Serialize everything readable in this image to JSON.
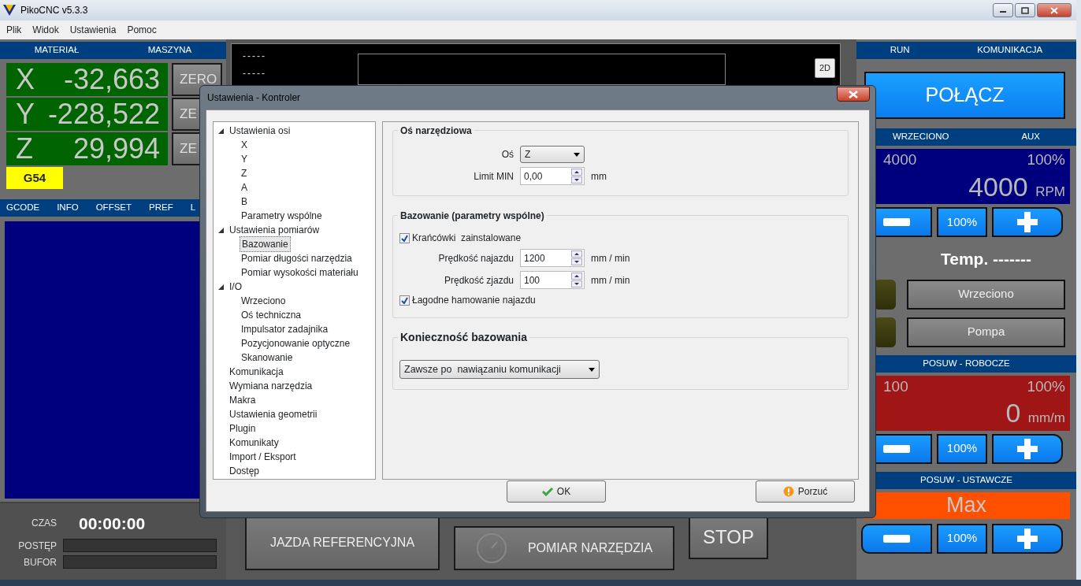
{
  "window": {
    "title": "PikoCNC v5.3.3"
  },
  "menu": [
    "Plik",
    "Widok",
    "Ustawienia",
    "Pomoc"
  ],
  "position": {
    "headers": [
      "MATERIAŁ",
      "MASZYNA"
    ],
    "axes": [
      {
        "axis": "X",
        "value": "-32,663",
        "button": "ZERO"
      },
      {
        "axis": "Y",
        "value": "-228,522",
        "button": "ZE"
      },
      {
        "axis": "Z",
        "value": "29,994",
        "button": "ZE"
      }
    ],
    "work_offset": "G54"
  },
  "left_tabs": [
    "GCODE",
    "INFO",
    "OFFSET",
    "PREF",
    "L"
  ],
  "status": {
    "time_label": "CZAS",
    "time": "00:00:00",
    "bars": [
      {
        "label": "POSTĘP",
        "level": 0
      },
      {
        "label": "BUFOR",
        "level": 0
      }
    ]
  },
  "viewport": {
    "lines": [
      "-----",
      "-----"
    ],
    "view_button": "2D"
  },
  "bottom_buttons": [
    {
      "label": "JAZDA REFERENCYJNA",
      "kind": "plain"
    },
    {
      "label": "POMIAR NARZĘDZIA",
      "kind": "gauge"
    },
    {
      "label": "STOP",
      "kind": "stop"
    }
  ],
  "connection": {
    "headers": [
      "RUN",
      "KOMUNIKACJA"
    ],
    "button": "POŁĄCZ"
  },
  "spindle": {
    "headers": [
      "WRZECIONO",
      "AUX"
    ],
    "set": "4000",
    "override": "100%",
    "value": "4000",
    "unit": "RPM",
    "reset": "100%"
  },
  "temperature": "Temp. -------",
  "outputs": [
    {
      "label": "Wrzeciono",
      "on": false
    },
    {
      "label": "Pompa",
      "on": false
    }
  ],
  "feed": {
    "header": "POSUW - ROBOCZE",
    "set": "100",
    "override": "100%",
    "value": "0",
    "unit": "mm/m",
    "reset": "100%"
  },
  "jog": {
    "header": "POSUW - USTAWCZE",
    "value": "Max",
    "reset": "100%"
  },
  "dialog": {
    "title": "Ustawienia - Kontroler",
    "tree": [
      {
        "label": "Ustawienia osi",
        "selected": false,
        "expanded": true,
        "children": [
          {
            "label": "X",
            "selected": false
          },
          {
            "label": "Y",
            "selected": false
          },
          {
            "label": "Z",
            "selected": false
          },
          {
            "label": "A",
            "selected": false
          },
          {
            "label": "B",
            "selected": false
          },
          {
            "label": "Parametry wspólne",
            "selected": false
          }
        ]
      },
      {
        "label": "Ustawienia pomiarów",
        "selected": false,
        "expanded": true,
        "children": [
          {
            "label": "Bazowanie",
            "selected": true
          },
          {
            "label": "Pomiar długości narzędzia",
            "selected": false
          },
          {
            "label": "Pomiar wysokości materiału",
            "selected": false
          }
        ]
      },
      {
        "label": "I/O",
        "selected": false,
        "expanded": true,
        "children": [
          {
            "label": "Wrzeciono",
            "selected": false
          },
          {
            "label": "Oś techniczna",
            "selected": false
          },
          {
            "label": "Impulsator zadajnika",
            "selected": false
          },
          {
            "label": "Pozycjonowanie optyczne",
            "selected": false
          },
          {
            "label": "Skanowanie",
            "selected": false
          }
        ]
      },
      {
        "label": "Komunikacja",
        "selected": false
      },
      {
        "label": "Wymiana narzędzia",
        "selected": false
      },
      {
        "label": "Makra",
        "selected": false
      },
      {
        "label": "Ustawienia geometrii",
        "selected": false
      },
      {
        "label": "Plugin",
        "selected": false
      },
      {
        "label": "Komunikaty",
        "selected": false
      },
      {
        "label": "Import / Eksport",
        "selected": false
      },
      {
        "label": "Dostęp",
        "selected": false
      }
    ],
    "sections": [
      {
        "title": "Oś narzędziowa",
        "rows": [
          {
            "kind": "select",
            "label": "Oś",
            "value": "Z"
          },
          {
            "kind": "spin",
            "label": "Limit MIN",
            "value": "0,00",
            "unit": "mm"
          }
        ]
      },
      {
        "title": "Bazowanie (parametry wspólne)",
        "rows": [
          {
            "kind": "checkbox",
            "label": "Krańcówki  zainstalowane",
            "checked": true
          },
          {
            "kind": "spin",
            "label": "Prędkość najazdu",
            "value": "1200",
            "unit": "mm / min"
          },
          {
            "kind": "spin",
            "label": "Prędkość zjazdu",
            "value": "100",
            "unit": "mm / min"
          },
          {
            "kind": "checkbox",
            "label": "Łagodne hamowanie najazdu",
            "checked": true
          }
        ]
      },
      {
        "title": "Konieczność bazowania",
        "rows": [
          {
            "kind": "wide-select",
            "value": "Zawsze po  nawiązaniu komunikacji"
          }
        ]
      }
    ],
    "buttons": [
      {
        "label": "OK",
        "kind": "ok"
      },
      {
        "label": "Porzuć",
        "kind": "cancel"
      }
    ]
  }
}
